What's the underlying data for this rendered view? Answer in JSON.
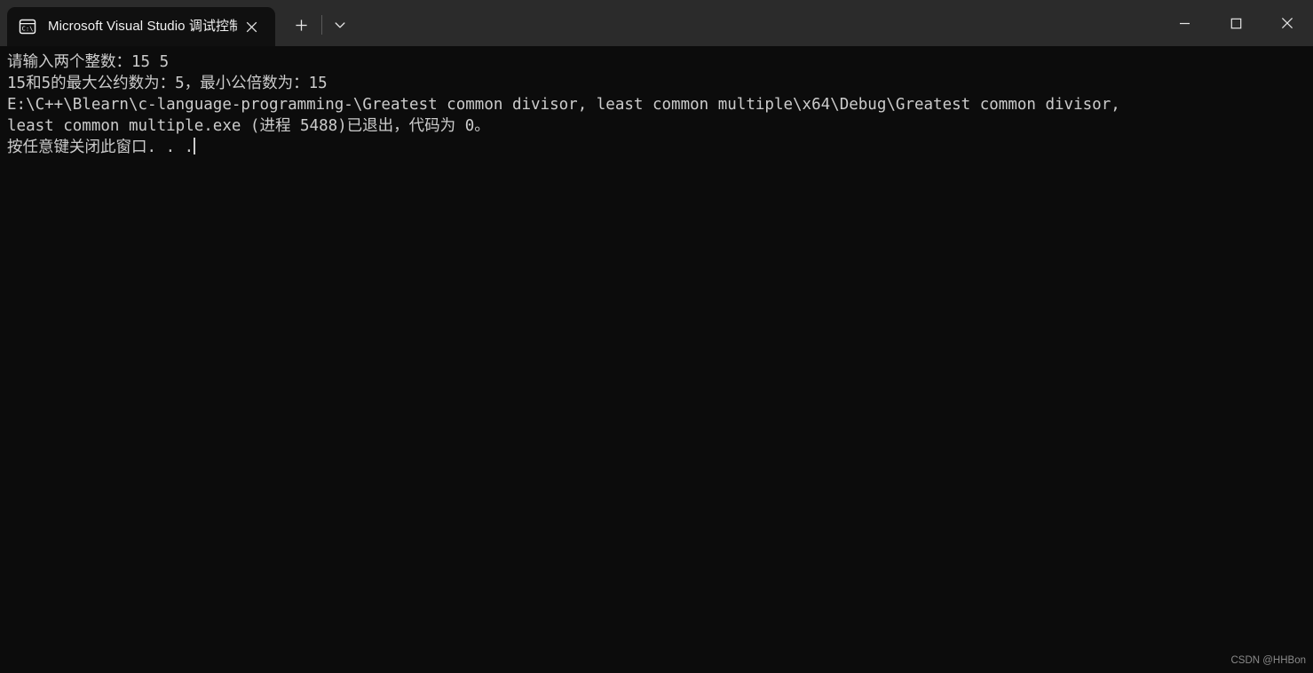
{
  "window": {
    "titlebar_color": "#2b2b2b",
    "console_bg_color": "#0c0c0c",
    "console_fg_color": "#cccccc",
    "tab": {
      "icon": "console-cmd-icon",
      "icon_label": "C:\\",
      "title": "Microsoft Visual Studio 调试控制台",
      "close_icon": "close-icon"
    },
    "new_tab_icon": "plus-icon",
    "tab_dropdown_icon": "chevron-down-icon",
    "controls": {
      "minimize_icon": "minimize-icon",
      "maximize_icon": "maximize-icon",
      "close_icon": "close-icon"
    }
  },
  "console": {
    "lines": [
      "请输入两个整数：15 5",
      "15和5的最大公约数为：5，最小公倍数为：15",
      "",
      "E:\\C++\\Blearn\\c-language-programming-\\Greatest common divisor, least common multiple\\x64\\Debug\\Greatest common divisor,",
      "least common multiple.exe (进程 5488)已退出，代码为 0。",
      "按任意键关闭此窗口. . ."
    ],
    "prompt": "请输入两个整数：",
    "input_values": "15 5",
    "gcd_value": "5",
    "lcm_value": "15",
    "process_id": "5488",
    "exit_code": "0",
    "executable_path": "E:\\C++\\Blearn\\c-language-programming-\\Greatest common divisor, least common multiple\\x64\\Debug\\Greatest common divisor, least common multiple.exe",
    "cursor_visible": true
  },
  "watermark": {
    "text": "CSDN @HHBon"
  }
}
